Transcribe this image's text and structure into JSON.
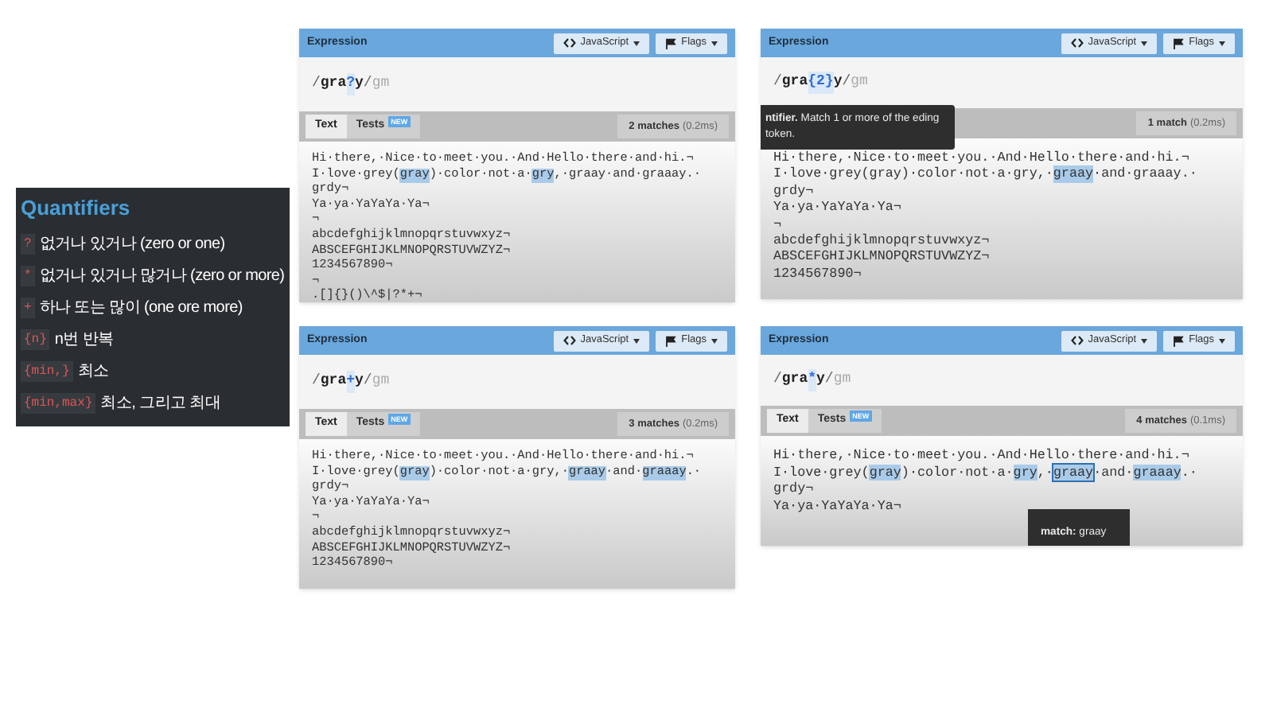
{
  "quantifiers": {
    "title": "Quantifiers",
    "items": [
      {
        "token": "?",
        "label": "없거나 있거나 (zero or one)"
      },
      {
        "token": "*",
        "label": "없거나 있거나 많거나 (zero or more)"
      },
      {
        "token": "+",
        "label": "하나 또는 많이 (one ore more)"
      },
      {
        "token": "{n}",
        "label": "n번 반복"
      },
      {
        "token": "{min,}",
        "label": "최소"
      },
      {
        "token": "{min,max}",
        "label": "최소, 그리고 최대"
      }
    ]
  },
  "panels": [
    {
      "title": "Expression",
      "language": "JavaScript",
      "flags_label": "Flags",
      "expression": [
        {
          "kind": "delimiter",
          "text": "/"
        },
        {
          "kind": "literal",
          "text": "gra"
        },
        {
          "kind": "quantifier",
          "text": "?"
        },
        {
          "kind": "literal",
          "text": "y"
        },
        {
          "kind": "delimiter",
          "text": "/"
        },
        {
          "kind": "flags",
          "text": "gm"
        }
      ],
      "tabs": [
        {
          "label": "Text",
          "selected": true
        },
        {
          "label": "Tests",
          "selected": false,
          "badge": "NEW"
        }
      ],
      "matches": "2 matches",
      "time": "(0.2ms)",
      "lines": [
        [
          {
            "text": "Hi·there,·Nice·to·meet·you.·And·Hello·there·and·hi.¬",
            "match": false
          }
        ],
        [
          {
            "text": "I·love·grey(",
            "match": false
          },
          {
            "text": "gray",
            "match": true,
            "hovered": false
          },
          {
            "text": ")·color·not·a·",
            "match": false
          },
          {
            "text": "gry",
            "match": true,
            "hovered": false
          },
          {
            "text": ",·graay·and·graaay.·",
            "match": false
          }
        ],
        [
          {
            "text": "grdy¬",
            "match": false
          }
        ],
        [
          {
            "text": "Ya·ya·YaYaYa·Ya¬",
            "match": false
          }
        ],
        [
          {
            "text": "¬",
            "match": false
          }
        ],
        [
          {
            "text": "abcdefghijklmnopqrstuvwxyz¬",
            "match": false
          }
        ],
        [
          {
            "text": "ABSCEFGHIJKLMNOPQRSTUVWZYZ¬",
            "match": false
          }
        ],
        [
          {
            "text": "1234567890¬",
            "match": false
          }
        ],
        [
          {
            "text": "¬",
            "match": false
          }
        ],
        [
          {
            "text": ".[]{}()\\^$|?*+¬",
            "match": false
          }
        ]
      ]
    },
    {
      "title": "Expression",
      "language": "JavaScript",
      "flags_label": "Flags",
      "expression": [
        {
          "kind": "delimiter",
          "text": "/"
        },
        {
          "kind": "literal",
          "text": "gra"
        },
        {
          "kind": "quantifier",
          "text": "{2}"
        },
        {
          "kind": "literal",
          "text": "y"
        },
        {
          "kind": "delimiter",
          "text": "/"
        },
        {
          "kind": "flags",
          "text": "gm"
        }
      ],
      "matches": "1 match",
      "time": "(0.2ms)",
      "tooltip": {
        "kind": "token",
        "text": "**ntifier.** Match 1 or more of the eding token."
      },
      "lines": [
        [
          {
            "text": "Hi·there,·Nice·to·meet·you.·And·Hello·there·and·hi.¬",
            "match": false
          }
        ],
        [
          {
            "text": "I·love·grey(gray)·color·not·a·gry,·",
            "match": false
          },
          {
            "text": "graay",
            "match": true,
            "hovered": false
          },
          {
            "text": "·and·graaay.·",
            "match": false
          }
        ],
        [
          {
            "text": "grdy¬",
            "match": false
          }
        ],
        [
          {
            "text": "Ya·ya·YaYaYa·Ya¬",
            "match": false
          }
        ],
        [
          {
            "text": "¬",
            "match": false
          }
        ],
        [
          {
            "text": "abcdefghijklmnopqrstuvwxyz¬",
            "match": false
          }
        ],
        [
          {
            "text": "ABSCEFGHIJKLMNOPQRSTUVWZYZ¬",
            "match": false
          }
        ],
        [
          {
            "text": "1234567890¬",
            "match": false
          }
        ]
      ]
    },
    {
      "title": "Expression",
      "language": "JavaScript",
      "flags_label": "Flags",
      "expression": [
        {
          "kind": "delimiter",
          "text": "/"
        },
        {
          "kind": "literal",
          "text": "gra"
        },
        {
          "kind": "quantifier",
          "text": "+"
        },
        {
          "kind": "literal",
          "text": "y"
        },
        {
          "kind": "delimiter",
          "text": "/"
        },
        {
          "kind": "flags",
          "text": "gm"
        }
      ],
      "tabs": [
        {
          "label": "Text",
          "selected": true
        },
        {
          "label": "Tests",
          "selected": false,
          "badge": "NEW"
        }
      ],
      "matches": "3 matches",
      "time": "(0.2ms)",
      "lines": [
        [
          {
            "text": "Hi·there,·Nice·to·meet·you.·And·Hello·there·and·hi.¬",
            "match": false
          }
        ],
        [
          {
            "text": "I·love·grey(",
            "match": false
          },
          {
            "text": "gray",
            "match": true,
            "hovered": false
          },
          {
            "text": ")·color·not·a·gry,·",
            "match": false
          },
          {
            "text": "graay",
            "match": true,
            "hovered": false
          },
          {
            "text": "·and·",
            "match": false
          },
          {
            "text": "graaay",
            "match": true,
            "hovered": false
          },
          {
            "text": ".·",
            "match": false
          }
        ],
        [
          {
            "text": "grdy¬",
            "match": false
          }
        ],
        [
          {
            "text": "Ya·ya·YaYaYa·Ya¬",
            "match": false
          }
        ],
        [
          {
            "text": "¬",
            "match": false
          }
        ],
        [
          {
            "text": "abcdefghijklmnopqrstuvwxyz¬",
            "match": false
          }
        ],
        [
          {
            "text": "ABSCEFGHIJKLMNOPQRSTUVWZYZ¬",
            "match": false
          }
        ],
        [
          {
            "text": "1234567890¬",
            "match": false
          }
        ]
      ]
    },
    {
      "title": "Expression",
      "language": "JavaScript",
      "flags_label": "Flags",
      "expression": [
        {
          "kind": "delimiter",
          "text": "/"
        },
        {
          "kind": "literal",
          "text": "gra"
        },
        {
          "kind": "quantifier",
          "text": "*"
        },
        {
          "kind": "literal",
          "text": "y"
        },
        {
          "kind": "delimiter",
          "text": "/"
        },
        {
          "kind": "flags",
          "text": "gm"
        }
      ],
      "tabs": [
        {
          "label": "Text",
          "selected": true
        },
        {
          "label": "Tests",
          "selected": false,
          "badge": "NEW"
        }
      ],
      "matches": "4 matches",
      "time": "(0.1ms)",
      "tooltip": {
        "kind": "match",
        "text": "**match:** graay"
      },
      "lines": [
        [
          {
            "text": "Hi·there,·Nice·to·meet·you.·And·Hello·there·and·hi.¬",
            "match": false
          }
        ],
        [
          {
            "text": "I·love·grey(",
            "match": false
          },
          {
            "text": "gray",
            "match": true,
            "hovered": false
          },
          {
            "text": ")·color·not·a·",
            "match": false
          },
          {
            "text": "gry",
            "match": true,
            "hovered": false
          },
          {
            "text": ",·",
            "match": false
          },
          {
            "text": "graay",
            "match": true,
            "hovered": true
          },
          {
            "text": "·and·",
            "match": false
          },
          {
            "text": "graaay",
            "match": true,
            "hovered": false
          },
          {
            "text": ".·",
            "match": false
          }
        ],
        [
          {
            "text": "grdy¬",
            "match": false
          }
        ],
        [
          {
            "text": "Ya·ya·YaYaYa·Ya¬",
            "match": false
          }
        ]
      ]
    }
  ]
}
